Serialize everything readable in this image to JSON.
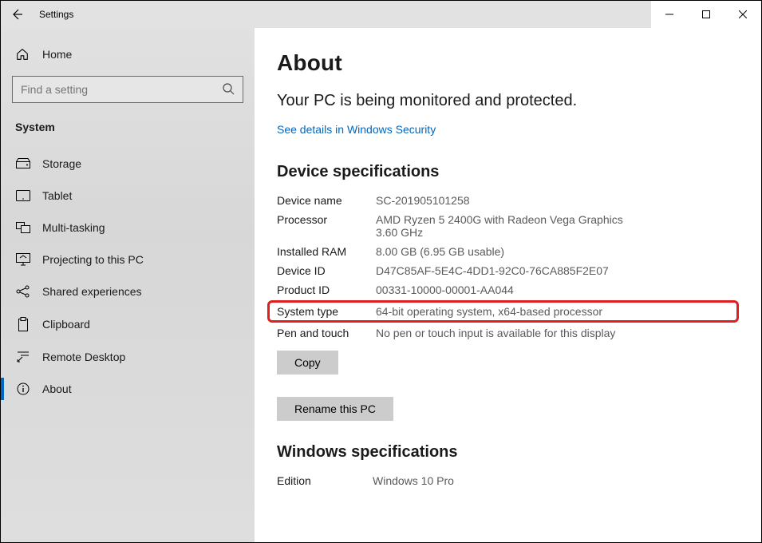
{
  "window": {
    "app_title": "Settings"
  },
  "sidebar": {
    "home_label": "Home",
    "search_placeholder": "Find a setting",
    "section_label": "System",
    "items": [
      {
        "id": "storage",
        "label": "Storage",
        "icon": "storage-icon"
      },
      {
        "id": "tablet",
        "label": "Tablet",
        "icon": "tablet-icon"
      },
      {
        "id": "multitasking",
        "label": "Multi-tasking",
        "icon": "multitasking-icon"
      },
      {
        "id": "projecting",
        "label": "Projecting to this PC",
        "icon": "projecting-icon"
      },
      {
        "id": "shared",
        "label": "Shared experiences",
        "icon": "shared-icon"
      },
      {
        "id": "clipboard",
        "label": "Clipboard",
        "icon": "clipboard-icon"
      },
      {
        "id": "remote",
        "label": "Remote Desktop",
        "icon": "remote-icon"
      },
      {
        "id": "about",
        "label": "About",
        "icon": "about-icon",
        "active": true
      }
    ]
  },
  "main": {
    "title": "About",
    "status": "Your PC is being monitored and protected.",
    "security_link": "See details in Windows Security",
    "device_spec_heading": "Device specifications",
    "specs": {
      "device_name": {
        "label": "Device name",
        "value": "SC-201905101258"
      },
      "processor": {
        "label": "Processor",
        "value": "AMD Ryzen 5 2400G with Radeon Vega Graphics 3.60 GHz"
      },
      "ram": {
        "label": "Installed RAM",
        "value": "8.00 GB (6.95 GB usable)"
      },
      "device_id": {
        "label": "Device ID",
        "value": "D47C85AF-5E4C-4DD1-92C0-76CA885F2E07"
      },
      "product_id": {
        "label": "Product ID",
        "value": "00331-10000-00001-AA044"
      },
      "system_type": {
        "label": "System type",
        "value": "64-bit operating system, x64-based processor"
      },
      "pen_touch": {
        "label": "Pen and touch",
        "value": "No pen or touch input is available for this display"
      }
    },
    "copy_button": "Copy",
    "rename_button": "Rename this PC",
    "windows_spec_heading": "Windows specifications",
    "windows_specs": {
      "edition": {
        "label": "Edition",
        "value": "Windows 10 Pro"
      }
    }
  }
}
